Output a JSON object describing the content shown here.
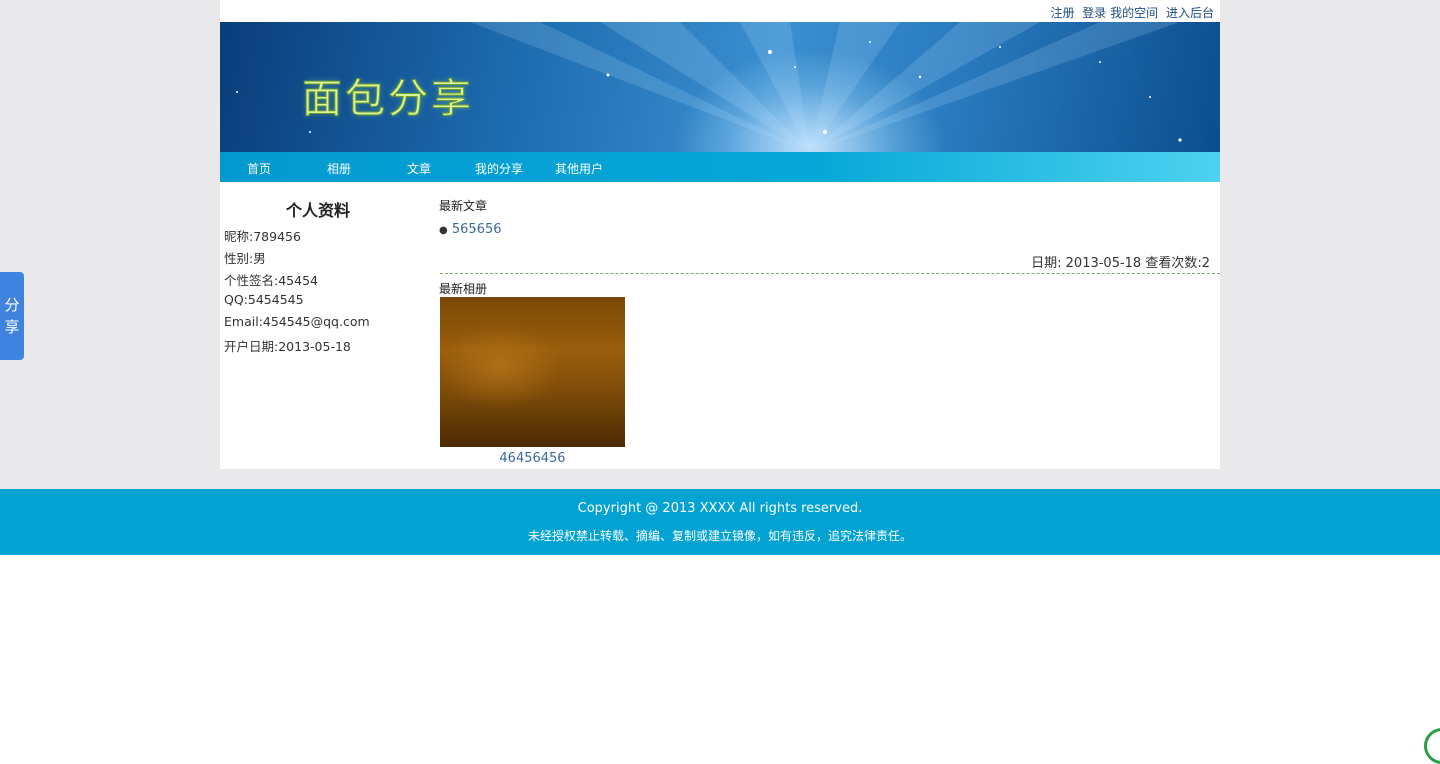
{
  "topbar": {
    "links": [
      "注册",
      "登录",
      "我的空间",
      "进入后台"
    ]
  },
  "banner": {
    "logo_text": "面包分享"
  },
  "nav": {
    "items": [
      "首页",
      "相册",
      "文章",
      "我的分享",
      "其他用户"
    ]
  },
  "profile": {
    "title": "个人资料",
    "nickname": "昵称:789456",
    "gender": "性别:男",
    "signature": "个性签名:45454",
    "qq": "QQ:5454545",
    "email": "Email:454545@qq.com",
    "opened": "开户日期:2013-05-18"
  },
  "articles": {
    "heading": "最新文章",
    "bullet": "●",
    "items": [
      {
        "title": "565656",
        "meta": "日期: 2013-05-18 查看次数:2"
      }
    ]
  },
  "albums": {
    "heading": "最新相册",
    "items": [
      {
        "caption": "46456456"
      }
    ]
  },
  "footer": {
    "copyright": "Copyright @ 2013 XXXX All rights reserved.",
    "notice": "未经授权禁止转载、摘编、复制或建立镜像，如有违反，追究法律责任。"
  },
  "share_widget": {
    "label_1": "分",
    "label_2": "享"
  },
  "colors": {
    "nav_bg": "#07a8d8",
    "footer_bg": "#02a3d3",
    "link": "#3c6a9e",
    "share_tab": "#3f83de",
    "page_bg": "#e9e9eb"
  }
}
